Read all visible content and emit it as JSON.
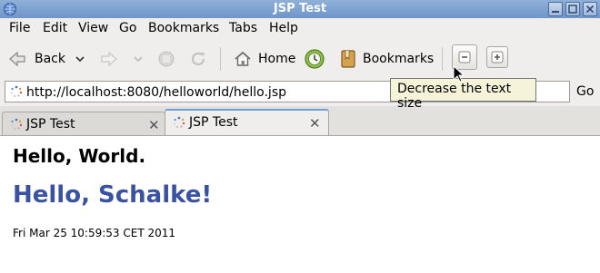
{
  "window": {
    "title": "JSP Test"
  },
  "menu": [
    "File",
    "Edit",
    "View",
    "Go",
    "Bookmarks",
    "Tabs",
    "Help"
  ],
  "toolbar": {
    "back_label": "Back",
    "home_label": "Home",
    "bookmarks_label": "Bookmarks"
  },
  "address": {
    "url": "http://localhost:8080/helloworld/hello.jsp",
    "go_label": "Go"
  },
  "tooltip": "Decrease the text size",
  "tabs": [
    {
      "label": "JSP Test",
      "active": false
    },
    {
      "label": "JSP Test",
      "active": true
    }
  ],
  "page": {
    "heading1": "Hello, World.",
    "heading2": "Hello, Schalke!",
    "date": "Fri Mar 25 10:59:53 CET 2011"
  },
  "colors": {
    "title_bar": "#7ca0d0",
    "heading2": "#3a52a2",
    "active_tab_accent": "#6f9ed6"
  }
}
